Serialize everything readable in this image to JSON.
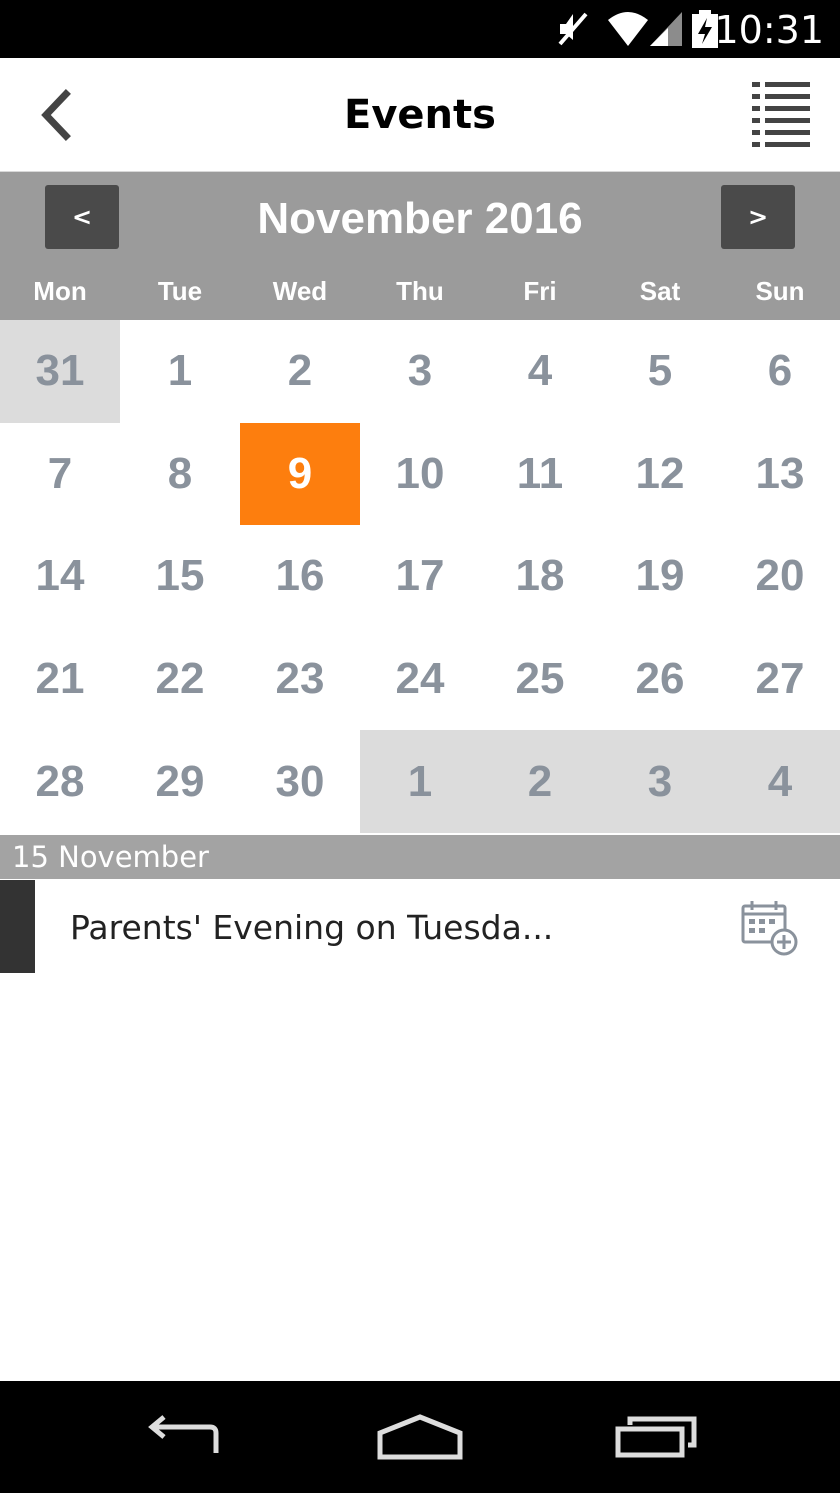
{
  "status_bar": {
    "time": "10:31",
    "icons": [
      "mute-icon",
      "wifi-icon",
      "cell-signal-icon",
      "battery-charging-icon"
    ]
  },
  "app_bar": {
    "title": "Events",
    "back_icon": "chevron-left-icon",
    "list_icon": "list-view-icon"
  },
  "calendar": {
    "month_label": "November 2016",
    "prev_label": "<",
    "next_label": ">",
    "weekdays": [
      "Mon",
      "Tue",
      "Wed",
      "Thu",
      "Fri",
      "Sat",
      "Sun"
    ],
    "days": [
      {
        "label": "31",
        "outside": true
      },
      {
        "label": "1"
      },
      {
        "label": "2"
      },
      {
        "label": "3"
      },
      {
        "label": "4"
      },
      {
        "label": "5"
      },
      {
        "label": "6"
      },
      {
        "label": "7"
      },
      {
        "label": "8"
      },
      {
        "label": "9",
        "today": true
      },
      {
        "label": "10"
      },
      {
        "label": "11"
      },
      {
        "label": "12"
      },
      {
        "label": "13"
      },
      {
        "label": "14"
      },
      {
        "label": "15"
      },
      {
        "label": "16"
      },
      {
        "label": "17"
      },
      {
        "label": "18"
      },
      {
        "label": "19"
      },
      {
        "label": "20"
      },
      {
        "label": "21"
      },
      {
        "label": "22"
      },
      {
        "label": "23"
      },
      {
        "label": "24"
      },
      {
        "label": "25"
      },
      {
        "label": "26"
      },
      {
        "label": "27"
      },
      {
        "label": "28"
      },
      {
        "label": "29"
      },
      {
        "label": "30"
      },
      {
        "label": "1",
        "outside": true
      },
      {
        "label": "2",
        "outside": true
      },
      {
        "label": "3",
        "outside": true
      },
      {
        "label": "4",
        "outside": true
      }
    ],
    "colors": {
      "header_bg": "#9b9b9b",
      "today_bg": "#fd7e0e",
      "outside_bg": "#dcdcdc",
      "day_text": "#8a929c"
    }
  },
  "events": {
    "date_header": "15 November",
    "items": [
      {
        "title": "Parents' Evening on Tuesda...",
        "action_icon": "calendar-add-icon"
      }
    ]
  },
  "nav_bar": {
    "buttons": [
      "back-nav-icon",
      "home-nav-icon",
      "recents-nav-icon"
    ]
  }
}
